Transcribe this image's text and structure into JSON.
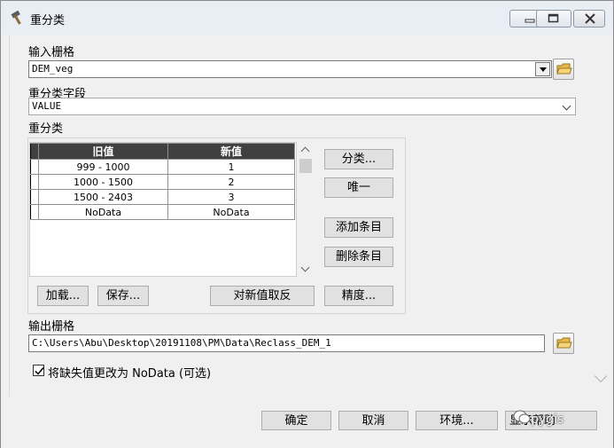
{
  "window": {
    "title": "重分类",
    "controls": [
      "minimize",
      "maximize",
      "close"
    ]
  },
  "input_raster": {
    "label": "输入栅格",
    "value": "DEM_veg"
  },
  "reclass_field": {
    "label": "重分类字段",
    "value": "VALUE"
  },
  "reclassification": {
    "label": "重分类",
    "columns": [
      "旧值",
      "新值"
    ],
    "rows": [
      {
        "old": "999 - 1000",
        "new": "1"
      },
      {
        "old": "1000 - 1500",
        "new": "2"
      },
      {
        "old": "1500 - 2403",
        "new": "3"
      },
      {
        "old": "NoData",
        "new": "NoData"
      }
    ],
    "buttons": {
      "classify": "分类...",
      "unique": "唯一",
      "add_entry": "添加条目",
      "delete_entry": "删除条目",
      "load": "加载...",
      "save": "保存...",
      "reverse_new_values": "对新值取反",
      "precision": "精度..."
    }
  },
  "output_raster": {
    "label": "输出栅格",
    "value": "C:\\Users\\Abu\\Desktop\\20191108\\PM\\Data\\Reclass_DEM_1"
  },
  "missing_to_nodata": {
    "label": "将缺失值更改为 NoData (可选)",
    "checked": true
  },
  "footer": {
    "ok": "确定",
    "cancel": "取消",
    "environments": "环境...",
    "show_help": "显示帮助"
  },
  "watermark": "pygis"
}
